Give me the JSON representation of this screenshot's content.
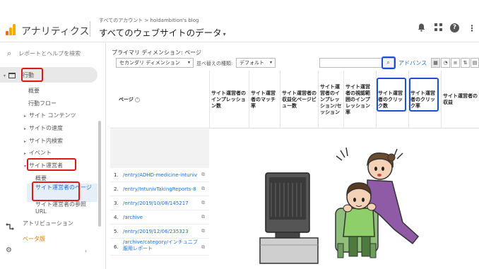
{
  "header": {
    "app_name": "アナリティクス",
    "breadcrumb": "すべてのアカウント > holdambition's blog",
    "view_title": "すべてのウェブサイトのデータ",
    "view_chevron": "▾",
    "icons": {
      "bell": "🔔",
      "apps": "⠿",
      "help": "?",
      "more": "⋮"
    }
  },
  "sidebar": {
    "search_placeholder": "レポートとヘルプを検索",
    "search_icon": "⌕",
    "behavior": "行動",
    "overview": "概要",
    "behavior_flow": "行動フロー",
    "site_content": "サイト コンテンツ",
    "site_speed": "サイトの速度",
    "site_search": "サイト内検索",
    "events": "イベント",
    "publisher": "サイト運営者",
    "pub_overview": "概要",
    "pub_pages": "サイト運営者のページ",
    "pub_referrals": "サイト運営者の参照 URL",
    "attribution": "アトリビューション",
    "beta": "ベータ版"
  },
  "content": {
    "primary_dimension": "プライマリ ディメンション: ページ",
    "secondary_dimension": "セカンダリ ディメンション",
    "sort_type_label": "並べ替えの種類:",
    "sort_default": "デフォルト",
    "advanced": "アドバンス",
    "search_btn": "⌕"
  },
  "table": {
    "page_header": "ページ",
    "columns": [
      "サイト運営者のインプレッション数",
      "サイト運営者のマッチ率",
      "サイト運営者の収益化ページビュー数",
      "サイト運営者のインプレッション/セッション",
      "サイト運営者の視認範囲のインプレッション率",
      "サイト運営者のクリック数",
      "サイト運営者のクリック率",
      "サイト運営者の収益"
    ],
    "rows": [
      {
        "num": "1.",
        "page": "/entry/ADHD-medicine-intuniv"
      },
      {
        "num": "2.",
        "page": "/entry/IntunivTakingReports-8"
      },
      {
        "num": "3.",
        "page": "/entry/2019/10/08/145217"
      },
      {
        "num": "4.",
        "page": "/archive"
      },
      {
        "num": "5.",
        "page": "/entry/2019/12/06/235323"
      },
      {
        "num": "6.",
        "page": "/archive/category/インチュニブ服用レポート"
      }
    ]
  },
  "colors": {
    "accent_blue": "#1a6fd6",
    "highlight_red": "#d91a1a",
    "highlight_blue": "#1a4fd6",
    "logo_orange": "#f9ab00",
    "logo_dark_orange": "#e37400"
  }
}
